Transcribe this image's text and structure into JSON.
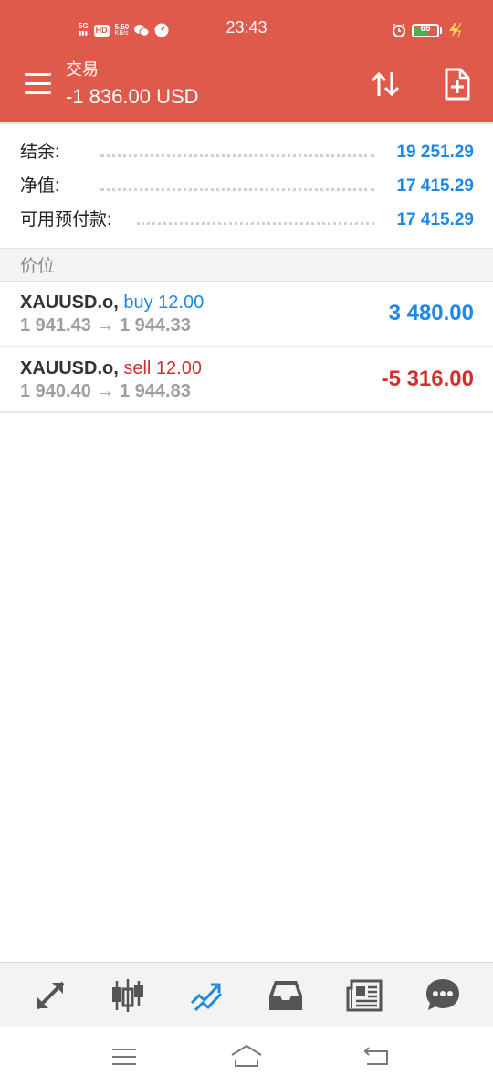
{
  "status_bar": {
    "network": "5G",
    "hd_badge": "HD",
    "speed_value": "5.50",
    "speed_unit": "KB/s",
    "time": "23:43",
    "battery": "66",
    "battery_level_percent": 66
  },
  "toolbar": {
    "title": "交易",
    "subtitle": "-1 836.00 USD"
  },
  "summary": [
    {
      "label": "结余:",
      "value": "19 251.29"
    },
    {
      "label": "净值:",
      "value": "17 415.29"
    },
    {
      "label": "可用预付款:",
      "value": "17 415.29"
    }
  ],
  "section_header": "价位",
  "positions": [
    {
      "symbol": "XAUUSD.o,",
      "side_volume": "buy 12.00",
      "side": "buy",
      "prices": "1 941.43 → 1 944.33",
      "profit": "3 480.00"
    },
    {
      "symbol": "XAUUSD.o,",
      "side_volume": "sell 12.00",
      "side": "sell",
      "prices": "1 940.40 → 1 944.83",
      "profit": "-5 316.00"
    }
  ],
  "bottom_nav": [
    {
      "icon": "trade-arrows-icon",
      "active": false
    },
    {
      "icon": "candlestick-chart-icon",
      "active": false
    },
    {
      "icon": "trade-trend-icon",
      "active": true
    },
    {
      "icon": "inbox-icon",
      "active": false
    },
    {
      "icon": "news-icon",
      "active": false
    },
    {
      "icon": "chat-icon",
      "active": false
    }
  ],
  "colors": {
    "header": "#e05a4c",
    "blue": "#1e88e5",
    "red": "#d32f2f",
    "nav_icon": "#555555",
    "nav_active": "#1e88e5"
  }
}
